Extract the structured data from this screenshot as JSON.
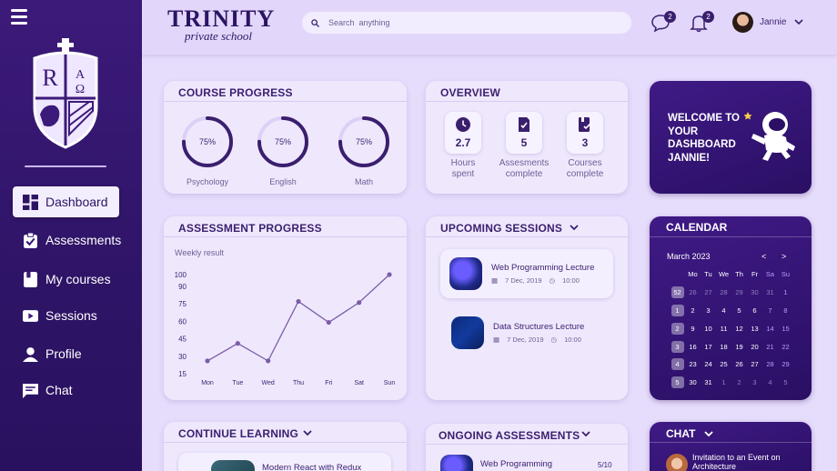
{
  "brand": {
    "title": "TRINITY",
    "subtitle": "private school"
  },
  "search": {
    "placeholder": "Search  anything"
  },
  "header": {
    "messages_badge": "2",
    "notifications_badge": "2",
    "user_name": "Jannie"
  },
  "sidebar": {
    "items": [
      {
        "label": "Dashboard",
        "icon": "dashboard-icon",
        "active": true
      },
      {
        "label": "Assessments",
        "icon": "assessment-icon"
      },
      {
        "label": "My courses",
        "icon": "book-icon"
      },
      {
        "label": "Sessions",
        "icon": "play-icon"
      },
      {
        "label": "Profile",
        "icon": "person-icon"
      },
      {
        "label": "Chat",
        "icon": "chat-icon"
      }
    ]
  },
  "course_progress": {
    "title": "COURSE PROGRESS",
    "courses": [
      {
        "name": "Psychology",
        "percent": 75,
        "label": "75%"
      },
      {
        "name": "English",
        "percent": 75,
        "label": "75%"
      },
      {
        "name": "Math",
        "percent": 75,
        "label": "75%"
      }
    ]
  },
  "overview": {
    "title": "OVERVIEW",
    "items": [
      {
        "value": "2.7",
        "label": "Hours spent",
        "icon": "clock-icon"
      },
      {
        "value": "5",
        "label": "Assesments complete",
        "icon": "task-icon"
      },
      {
        "value": "3",
        "label": "Courses complete",
        "icon": "courses-icon"
      }
    ]
  },
  "welcome": {
    "text": "WELCOME TO YOUR DASHBOARD JANNIE!"
  },
  "assessment_progress": {
    "title": "ASSESSMENT PROGRESS",
    "subtitle": "Weekly result"
  },
  "chart_data": {
    "type": "line",
    "title": "Weekly result",
    "categories": [
      "Mon",
      "Tue",
      "Wed",
      "Thu",
      "Fri",
      "Sat",
      "Sun"
    ],
    "values": [
      26,
      41,
      26,
      77,
      59,
      76,
      100
    ],
    "yticks": [
      15,
      30,
      45,
      60,
      75,
      90,
      100
    ],
    "ylim": [
      15,
      100
    ],
    "grid": false,
    "color": "#7b5ea8"
  },
  "upcoming_sessions": {
    "title": "UPCOMING SESSIONS",
    "items": [
      {
        "title": "Web Programming Lecture",
        "date": "7 Dec, 2019",
        "time": "10:00"
      },
      {
        "title": "Data Structures Lecture",
        "date": "7 Dec, 2019",
        "time": "10:00"
      }
    ]
  },
  "calendar": {
    "title": "CALENDAR",
    "month": "March 2023",
    "prev": "<",
    "next": ">",
    "headers": [
      "",
      "Mo",
      "Tu",
      "We",
      "Th",
      "Fr",
      "Sa",
      "Su"
    ],
    "rows": [
      [
        "52",
        "26",
        "27",
        "28",
        "29",
        "30",
        "31",
        "1"
      ],
      [
        "1",
        "2",
        "3",
        "4",
        "5",
        "6",
        "7",
        "8"
      ],
      [
        "2",
        "9",
        "10",
        "11",
        "12",
        "13",
        "14",
        "15"
      ],
      [
        "3",
        "16",
        "17",
        "18",
        "19",
        "20",
        "21",
        "22"
      ],
      [
        "4",
        "23",
        "24",
        "25",
        "26",
        "27",
        "28",
        "29"
      ],
      [
        "5",
        "30",
        "31",
        "1",
        "2",
        "3",
        "4",
        "5"
      ]
    ]
  },
  "continue_learning": {
    "title": "CONTINUE LEARNING",
    "item_title": "Modern React with Redux"
  },
  "ongoing_assessments": {
    "title": "ONGOING ASSESSMENTS",
    "item_title": "Web Programming",
    "item_progress": "5/10"
  },
  "chat": {
    "title": "CHAT",
    "item_text": "Invitation to an Event on Architecture"
  },
  "colors": {
    "sidebar": "#2e1466",
    "accent": "#3a1f6e",
    "background": "#e6dcfb",
    "card": "#efe8fd"
  }
}
